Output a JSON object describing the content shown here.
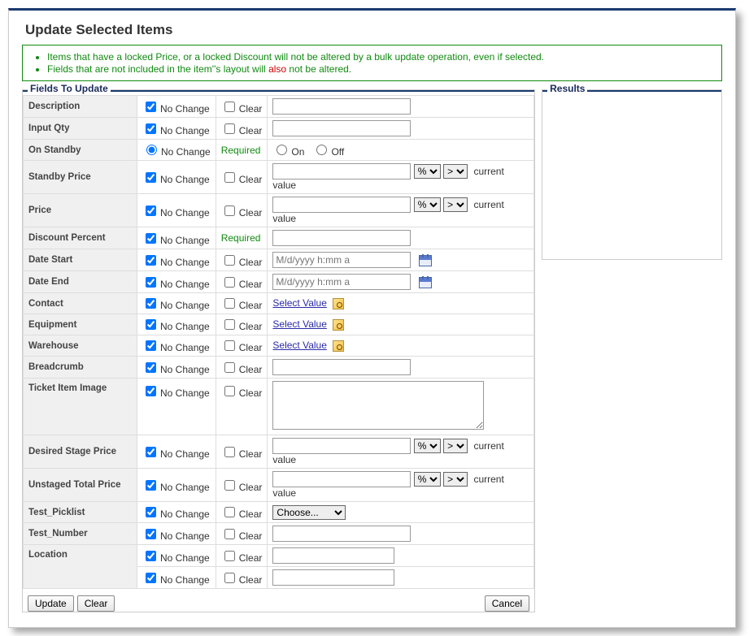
{
  "dialog": {
    "title": "Update Selected Items"
  },
  "notes": {
    "line1": "Items that have a locked Price, or a locked Discount will not be altered by a bulk update operation, even if selected.",
    "line2_a": "Fields that are not included in the item''s layout will ",
    "line2_red": "also",
    "line2_b": " not be altered."
  },
  "legends": {
    "fields": "Fields To Update",
    "results": "Results"
  },
  "ui": {
    "noChange": "No Change",
    "clear": "Clear",
    "required": "Required",
    "selectValue": "Select Value",
    "currentValue": "current value",
    "on": "On",
    "off": "Off",
    "datePlaceholder": "M/d/yyyy h:mm a",
    "choose": "Choose...",
    "pct": "%",
    "gt": ">"
  },
  "buttons": {
    "update": "Update",
    "clear": "Clear",
    "cancel": "Cancel"
  },
  "fields": {
    "description": "Description",
    "inputQty": "Input Qty",
    "onStandby": "On Standby",
    "standbyPrice": "Standby Price",
    "price": "Price",
    "discountPercent": "Discount Percent",
    "dateStart": "Date Start",
    "dateEnd": "Date End",
    "contact": "Contact",
    "equipment": "Equipment",
    "warehouse": "Warehouse",
    "breadcrumb": "Breadcrumb",
    "ticketItemImage": "Ticket Item Image",
    "desiredStagePrice": "Desired Stage Price",
    "unstagedTotalPrice": "Unstaged Total Price",
    "testPicklist": "Test_Picklist",
    "testNumber": "Test_Number",
    "location": "Location"
  }
}
